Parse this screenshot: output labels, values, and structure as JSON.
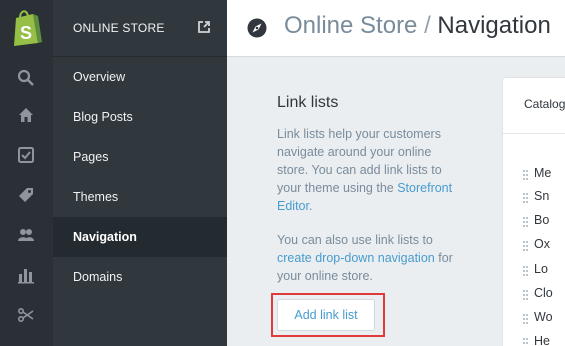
{
  "sidebar": {
    "section_title": "ONLINE STORE",
    "items": [
      {
        "label": "Overview"
      },
      {
        "label": "Blog Posts"
      },
      {
        "label": "Pages"
      },
      {
        "label": "Themes"
      },
      {
        "label": "Navigation"
      },
      {
        "label": "Domains"
      }
    ],
    "active_item": "Navigation"
  },
  "rail": {
    "icons": [
      "shopify-logo-icon",
      "search-icon",
      "home-icon",
      "orders-icon",
      "tag-icon",
      "customers-icon",
      "reports-icon",
      "discounts-icon"
    ]
  },
  "header": {
    "breadcrumb": "Online Store",
    "separator": "/",
    "title": "Navigation"
  },
  "link_lists": {
    "title": "Link lists",
    "desc1_text": "Link lists help your customers navigate around your online store. You can add link lists to your theme using the ",
    "desc1_link": "Storefront Editor",
    "desc1_end": ".",
    "desc2_text": "You can also use link lists to ",
    "desc2_link": "create drop-down navigation",
    "desc2_end": " for your online store.",
    "add_button": "Add link list"
  },
  "catalog_card": {
    "title": "Catalog",
    "items": [
      "Me",
      "Sn",
      "Bo",
      "Ox",
      "Lo",
      "Clo",
      "Wo",
      "He"
    ]
  },
  "colors": {
    "accent": "#479ccf",
    "highlight": "#e03b3b",
    "sidebar_bg": "#30373d",
    "rail_bg": "#2a3036",
    "logo_green": "#95bf47"
  }
}
